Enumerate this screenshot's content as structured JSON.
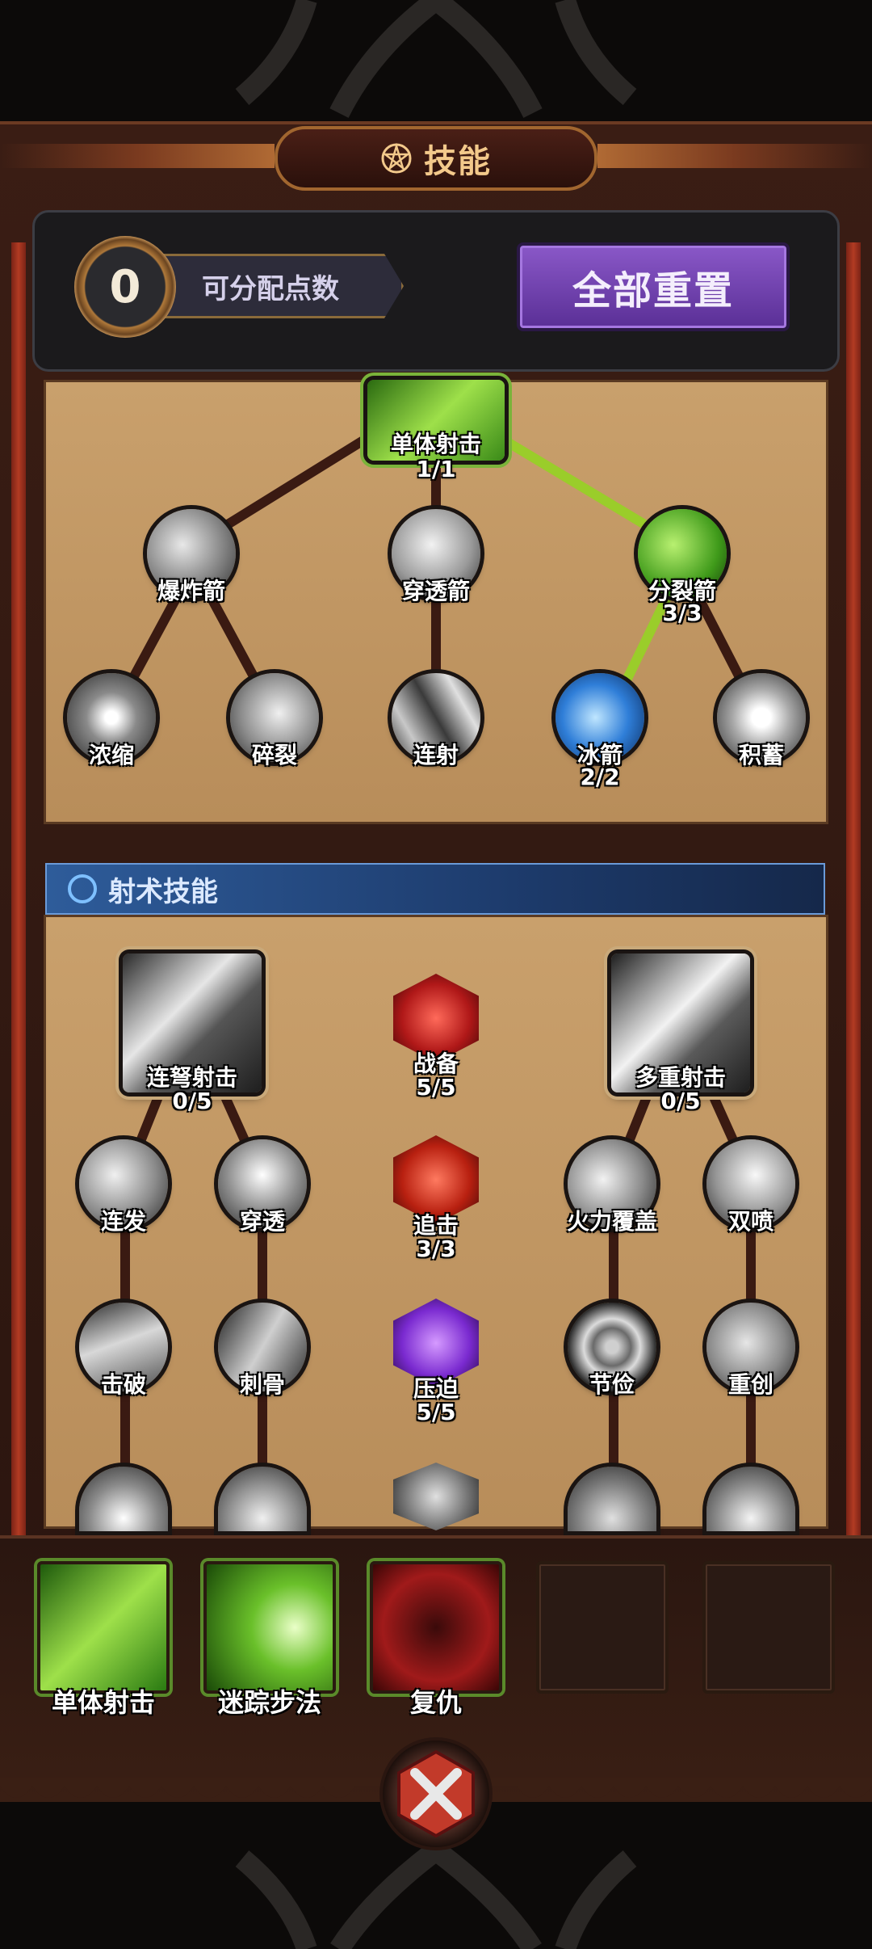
{
  "title": "技能",
  "header": {
    "points_value": "0",
    "points_label": "可分配点数",
    "reset_label": "全部重置"
  },
  "section2_title": "射术技能",
  "tree1": {
    "root": {
      "label": "单体射击",
      "count": "1/1"
    },
    "row1": [
      {
        "label": "爆炸箭",
        "count": ""
      },
      {
        "label": "穿透箭",
        "count": ""
      },
      {
        "label": "分裂箭",
        "count": "3/3"
      }
    ],
    "row2": [
      {
        "label": "浓缩",
        "count": ""
      },
      {
        "label": "碎裂",
        "count": ""
      },
      {
        "label": "连射",
        "count": ""
      },
      {
        "label": "冰箭",
        "count": "2/2"
      },
      {
        "label": "积蓄",
        "count": ""
      }
    ]
  },
  "tree2": {
    "left_root": {
      "label": "连弩射击",
      "count": "0/5"
    },
    "right_root": {
      "label": "多重射击",
      "count": "0/5"
    },
    "center": [
      {
        "label": "战备",
        "count": "5/5"
      },
      {
        "label": "追击",
        "count": "3/3"
      },
      {
        "label": "压迫",
        "count": "5/5"
      }
    ],
    "row_a": [
      {
        "label": "连发"
      },
      {
        "label": "穿透"
      },
      {
        "label": "火力覆盖"
      },
      {
        "label": "双喷"
      }
    ],
    "row_b": [
      {
        "label": "击破"
      },
      {
        "label": "刺骨"
      },
      {
        "label": "节俭"
      },
      {
        "label": "重创"
      }
    ]
  },
  "equipped": [
    {
      "label": "单体射击"
    },
    {
      "label": "迷踪步法"
    },
    {
      "label": "复仇"
    },
    {
      "label": ""
    },
    {
      "label": ""
    }
  ],
  "colors": {
    "active_link": "#9acd2a",
    "inactive_link": "#3a1a12",
    "accent_purple": "#7a4ab8"
  }
}
